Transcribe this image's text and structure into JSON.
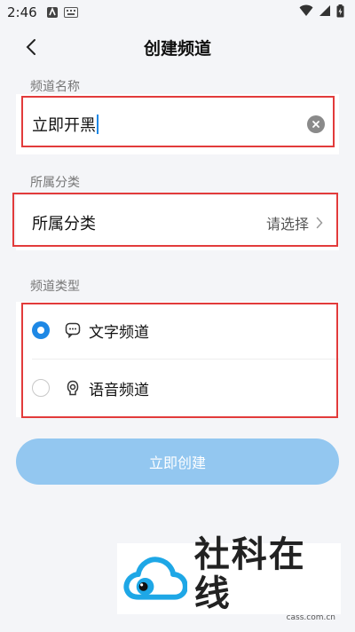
{
  "status_bar": {
    "time": "2:46"
  },
  "header": {
    "title": "创建频道"
  },
  "channel_name": {
    "label": "频道名称",
    "value": "立即开黑"
  },
  "category": {
    "section_label": "所属分类",
    "row_label": "所属分类",
    "placeholder": "请选择"
  },
  "channel_type": {
    "section_label": "频道类型",
    "options": [
      {
        "label": "文字频道",
        "selected": true,
        "icon": "chat-bubble-icon"
      },
      {
        "label": "语音频道",
        "selected": false,
        "icon": "voice-icon"
      }
    ]
  },
  "create_button": {
    "label": "立即创建"
  },
  "watermark": {
    "title": "社科在线",
    "url": "cass.com.cn"
  },
  "colors": {
    "accent": "#1e88e5",
    "button_disabled": "#93c7f0",
    "highlight_box": "#e23b3b"
  }
}
